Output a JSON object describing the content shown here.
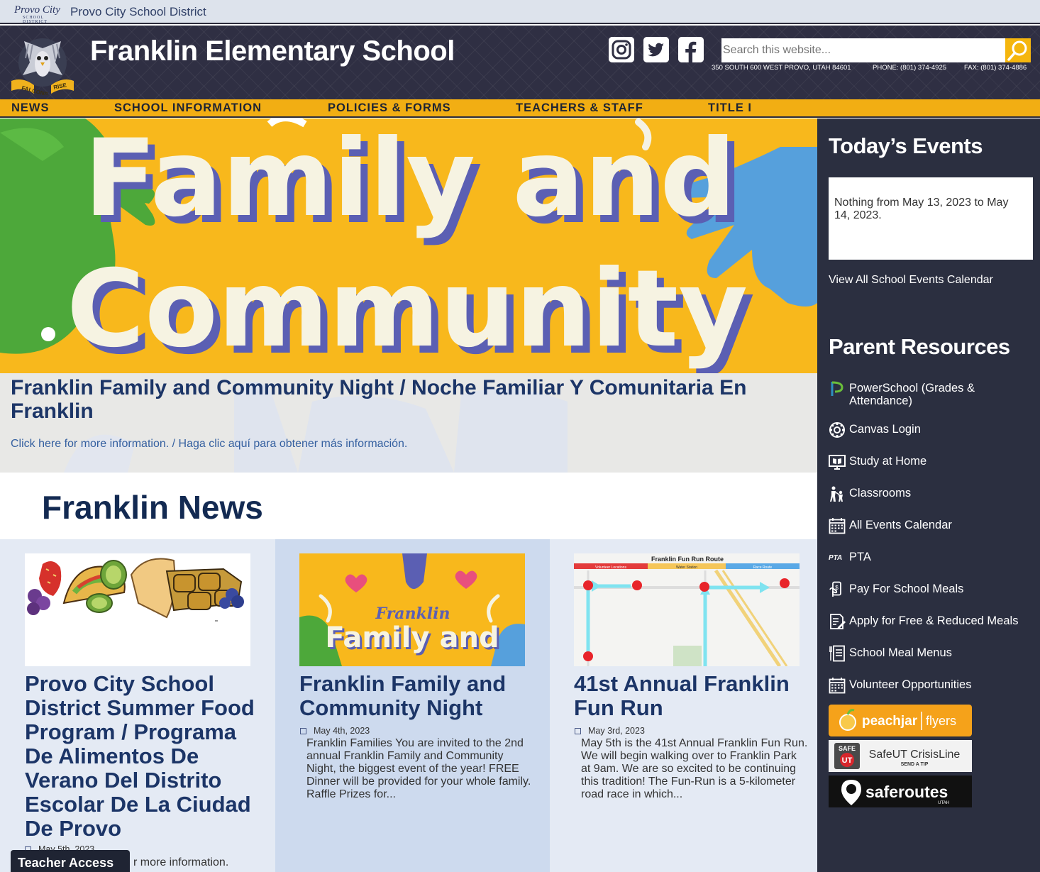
{
  "district": {
    "logo_text": "Provo City",
    "logo_sub": "SCHOOL DISTRICT",
    "name": "Provo City School District"
  },
  "header": {
    "title": "Franklin Elementary School",
    "logo_banner_left": "FALCONS",
    "logo_banner_right": "RISE",
    "search_placeholder": "Search this website...",
    "address": "350 SOUTH 600 WEST PROVO, UTAH 84601",
    "phone": "PHONE: (801) 374-4925",
    "fax": "FAX: (801) 374-4886"
  },
  "nav": {
    "items": [
      "NEWS",
      "SCHOOL INFORMATION",
      "POLICIES & FORMS",
      "TEACHERS & STAFF",
      "TITLE I"
    ]
  },
  "hero": {
    "line1": "Family and",
    "line2": "Community",
    "caption_title": "Franklin Family and Community Night / Noche Familiar Y Comunitaria En Franklin",
    "caption_link": "Click here for more information. / Haga clic aquí para obtener más información."
  },
  "news": {
    "heading": "Franklin News",
    "items": [
      {
        "title": "Provo City School District Summer Food Program / Programa De Alimentos De Verano Del Distrito Escolar De La Ciudad De Provo",
        "date": "May 5th, 2023",
        "excerpt": "r more information."
      },
      {
        "title": "Franklin Family and Community Night",
        "date": "May 4th, 2023",
        "excerpt": "Franklin Families You are invited to the 2nd annual Franklin Family and Community Night, the biggest event of the year! FREE Dinner will be provided for your whole family. Raffle Prizes for...",
        "img_word1": "Franklin",
        "img_word2": "Family and"
      },
      {
        "title": "41st Annual Franklin Fun Run",
        "date": "May 3rd, 2023",
        "excerpt": "May 5th is the 41st Annual Franklin Fun Run. We will begin walking over to Franklin Park at 9am. We are so excited to be continuing this tradition! The Fun-Run is a 5-kilometer road race in which...",
        "map_title": "Franklin Fun Run Route",
        "map_legend": [
          "Volunteer Locations",
          "Water Station",
          "Race Route"
        ]
      }
    ]
  },
  "teacher_access": "Teacher Access",
  "sidebar": {
    "events_heading": "Today’s Events",
    "events_empty": "Nothing from May 13, 2023 to May 14, 2023.",
    "events_link": "View All School Events Calendar",
    "resources_heading": "Parent Resources",
    "resources": [
      {
        "label": "PowerSchool (Grades & Attendance)",
        "icon": "powerschool-icon"
      },
      {
        "label": "Canvas Login",
        "icon": "canvas-icon"
      },
      {
        "label": "Study at Home",
        "icon": "book-icon"
      },
      {
        "label": "Classrooms",
        "icon": "classroom-icon"
      },
      {
        "label": "All Events Calendar",
        "icon": "calendar-icon"
      },
      {
        "label": "PTA",
        "icon": "pta-icon"
      },
      {
        "label": "Pay For School Meals",
        "icon": "payment-icon"
      },
      {
        "label": "Apply for Free & Reduced Meals",
        "icon": "form-icon"
      },
      {
        "label": "School Meal Menus",
        "icon": "menu-icon"
      },
      {
        "label": "Volunteer Opportunities",
        "icon": "calendar-icon"
      }
    ],
    "pta_mark": "PTA",
    "badges": {
      "peachjar_left": "peachjar",
      "peachjar_right": "flyers",
      "safeut_top": "SAFE",
      "safeut_mid": "UT",
      "safeut_name": "SafeUT CrisisLine",
      "safeut_sub": "SEND A TIP",
      "saferoutes_name": "saferoutes",
      "saferoutes_sub": "UTAH"
    }
  },
  "colors": {
    "gold": "#f2ae13",
    "navy": "#1c3567",
    "dark": "#2b2f40",
    "lavender": "#5a5fb0"
  }
}
